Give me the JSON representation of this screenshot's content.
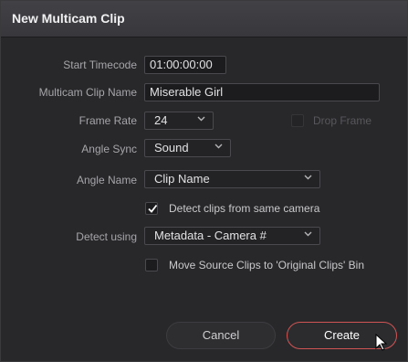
{
  "dialog": {
    "title": "New Multicam Clip"
  },
  "form": {
    "start_timecode": {
      "label": "Start Timecode",
      "value": "01:00:00:00"
    },
    "clip_name": {
      "label": "Multicam Clip Name",
      "value": "Miserable Girl"
    },
    "frame_rate": {
      "label": "Frame Rate",
      "value": "24"
    },
    "drop_frame": {
      "label": "Drop Frame",
      "checked": false,
      "enabled": false
    },
    "angle_sync": {
      "label": "Angle Sync",
      "value": "Sound"
    },
    "angle_name": {
      "label": "Angle Name",
      "value": "Clip Name"
    },
    "detect_same_camera": {
      "label": "Detect clips from same camera",
      "checked": true
    },
    "detect_using": {
      "label": "Detect using",
      "value": "Metadata - Camera #"
    },
    "move_source": {
      "label": "Move Source Clips to 'Original Clips' Bin",
      "checked": false
    }
  },
  "buttons": {
    "cancel_label": "Cancel",
    "create_label": "Create"
  },
  "colors": {
    "accent": "#d05454",
    "background": "#28282b",
    "titlebar": "#3c3c40"
  }
}
